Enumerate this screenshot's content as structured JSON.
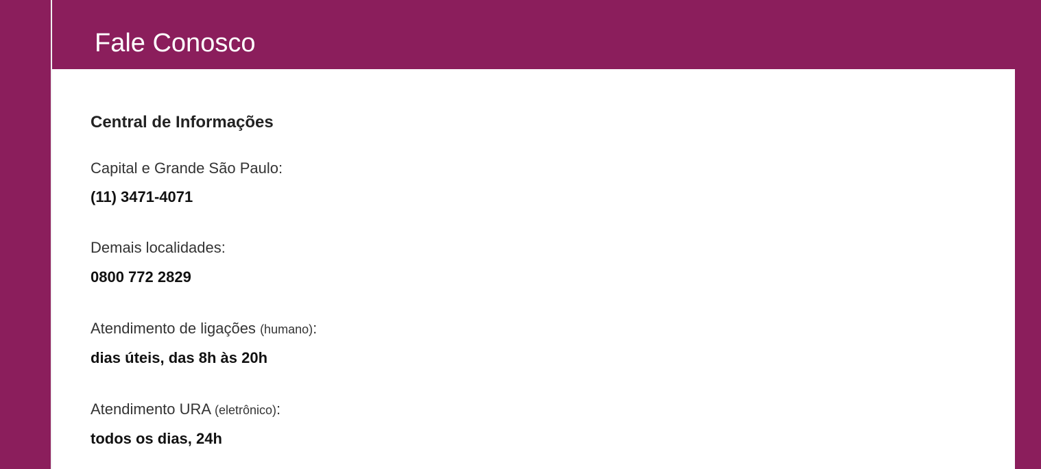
{
  "page": {
    "title": "Fale Conosco"
  },
  "section": {
    "title": "Central de Informações"
  },
  "contacts": {
    "capital": {
      "label": "Capital e Grande São Paulo:",
      "value": "(11) 3471-4071"
    },
    "demais": {
      "label": "Demais localidades:",
      "value": "0800 772 2829"
    },
    "ligacoes": {
      "label_main": "Atendimento de ligações ",
      "label_note": "(humano)",
      "label_end": ":",
      "value": "dias úteis, das 8h às 20h"
    },
    "ura": {
      "label_main": "Atendimento URA ",
      "label_note": "(eletrônico)",
      "label_end": ":",
      "value": "todos os dias, 24h"
    }
  },
  "colors": {
    "brand": "#8b1e5c",
    "panel_background": "#ffffff",
    "text_primary": "#222222",
    "text_secondary": "#333333"
  }
}
